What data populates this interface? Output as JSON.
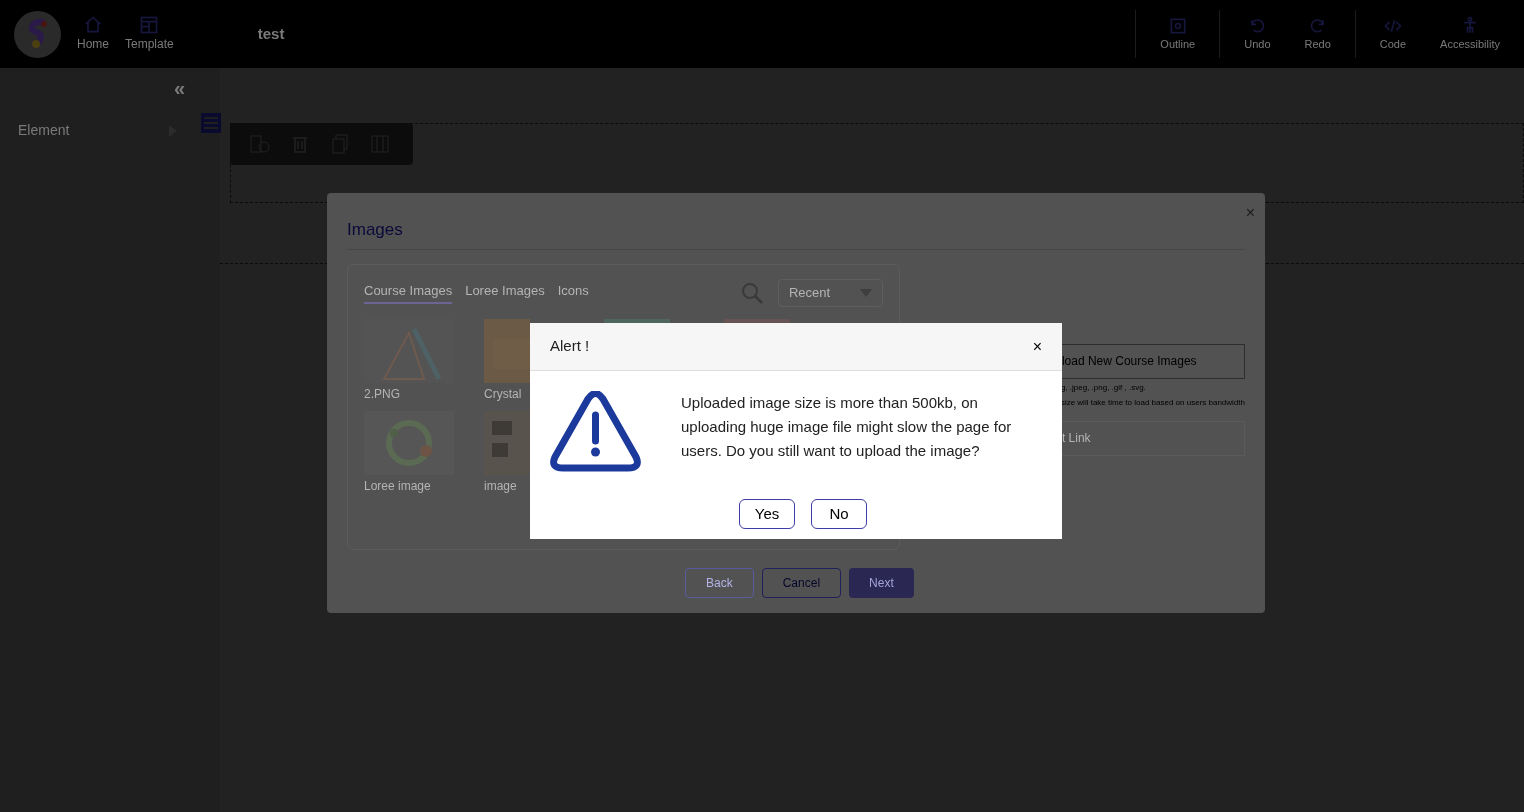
{
  "header": {
    "nav": [
      {
        "label": "Home"
      },
      {
        "label": "Template"
      }
    ],
    "title": "test",
    "tools": [
      {
        "label": "Outline",
        "group_start": true
      },
      {
        "label": "Undo",
        "group_start": true
      },
      {
        "label": "Redo",
        "group_start": false
      },
      {
        "label": "Code",
        "group_start": true
      },
      {
        "label": "Accessibility",
        "group_start": false
      }
    ]
  },
  "sidebar": {
    "collapse": "«",
    "items": [
      {
        "label": "Element",
        "expanded": false
      }
    ]
  },
  "images_dialog": {
    "title": "Images",
    "close": "×",
    "tabs": [
      {
        "label": "Course Images",
        "selected": true
      },
      {
        "label": "Loree Images",
        "selected": false
      },
      {
        "label": "Icons",
        "selected": false
      }
    ],
    "sort": {
      "value": "Recent"
    },
    "grid": [
      {
        "label": "2.PNG",
        "kind": "triangle"
      },
      {
        "label": "Crystal",
        "kind": "poster"
      },
      {
        "kind": "green"
      },
      {
        "kind": "pink"
      },
      {
        "label": "Loree image",
        "kind": "wreath"
      },
      {
        "label": "image",
        "kind": "text"
      }
    ],
    "upload_button": "load New Course Images",
    "upload_notes": [
      "g, .jpeg, .png, .gif , .svg.",
      "size will take time to load based on users bandwidth"
    ],
    "link_field": {
      "placeholder": "t Link"
    },
    "buttons": [
      {
        "label": "Back",
        "kind": "outline"
      },
      {
        "label": "Cancel",
        "kind": "outline-dark"
      },
      {
        "label": "Next",
        "kind": "primary"
      }
    ]
  },
  "alert": {
    "title": "Alert !",
    "close": "×",
    "message": "Uploaded image size is more than 500kb, on uploading huge image file might slow the page for users. Do you still want to upload the image?",
    "buttons": [
      "Yes",
      "No"
    ]
  }
}
